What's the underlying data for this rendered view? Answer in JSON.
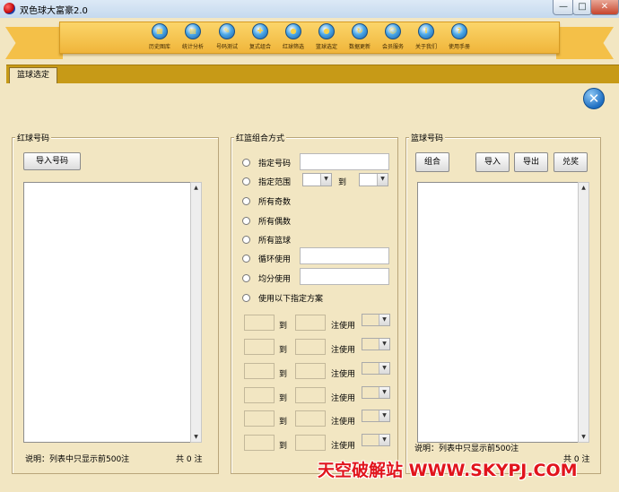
{
  "window": {
    "title": "双色球大富豪2.0",
    "min_label": "—",
    "max_label": "□",
    "close_label": "✕"
  },
  "menu": [
    {
      "label": "历史图库",
      "icon": "history-chart-icon",
      "glyph": "▦"
    },
    {
      "label": "统计分析",
      "icon": "statistics-icon",
      "glyph": "▤"
    },
    {
      "label": "号码测试",
      "icon": "number-test-icon",
      "glyph": "✎"
    },
    {
      "label": "复式组合",
      "icon": "compound-combo-icon",
      "glyph": "✚"
    },
    {
      "label": "红球筛选",
      "icon": "red-ball-filter-icon",
      "glyph": "●"
    },
    {
      "label": "篮球选定",
      "icon": "blue-ball-select-icon",
      "glyph": "●"
    },
    {
      "label": "数据更新",
      "icon": "data-update-icon",
      "glyph": "↻"
    },
    {
      "label": "会员服务",
      "icon": "member-service-icon",
      "glyph": "☺"
    },
    {
      "label": "关于我们",
      "icon": "about-us-icon",
      "glyph": "i"
    },
    {
      "label": "使用手册",
      "icon": "user-manual-icon",
      "glyph": "?"
    }
  ],
  "tab": {
    "label": "篮球选定"
  },
  "close_button_glyph": "✕",
  "red_panel": {
    "title": "红球号码",
    "import_button": "导入号码",
    "note": "说明：列表中只显示前500注",
    "count_prefix": "共",
    "count": "0",
    "count_suffix": "注"
  },
  "combo_panel": {
    "title": "红篮组合方式",
    "options": {
      "specified_numbers": "指定号码",
      "specified_range": "指定范围",
      "range_to": "到",
      "all_odd": "所有奇数",
      "all_even": "所有偶数",
      "all_blue": "所有篮球",
      "cyclic_use": "循环使用",
      "even_split": "均分使用",
      "use_schemes": "使用以下指定方案"
    },
    "scheme_to": "到",
    "scheme_use": "注使用"
  },
  "blue_panel": {
    "title": "篮球号码",
    "combine_button": "组合",
    "import_button": "导入",
    "export_button": "导出",
    "redeem_button": "兑奖",
    "note": "说明：列表中只显示前500注",
    "count_prefix": "共",
    "count": "0",
    "count_suffix": "注"
  },
  "watermark": {
    "text": "天空破解站 WWW.SKYPJ.COM"
  },
  "colors": {
    "ribbon": "#f0b53a",
    "tab_strip": "#c79a17",
    "background": "#f2e6c2",
    "watermark": "#e1141c"
  }
}
